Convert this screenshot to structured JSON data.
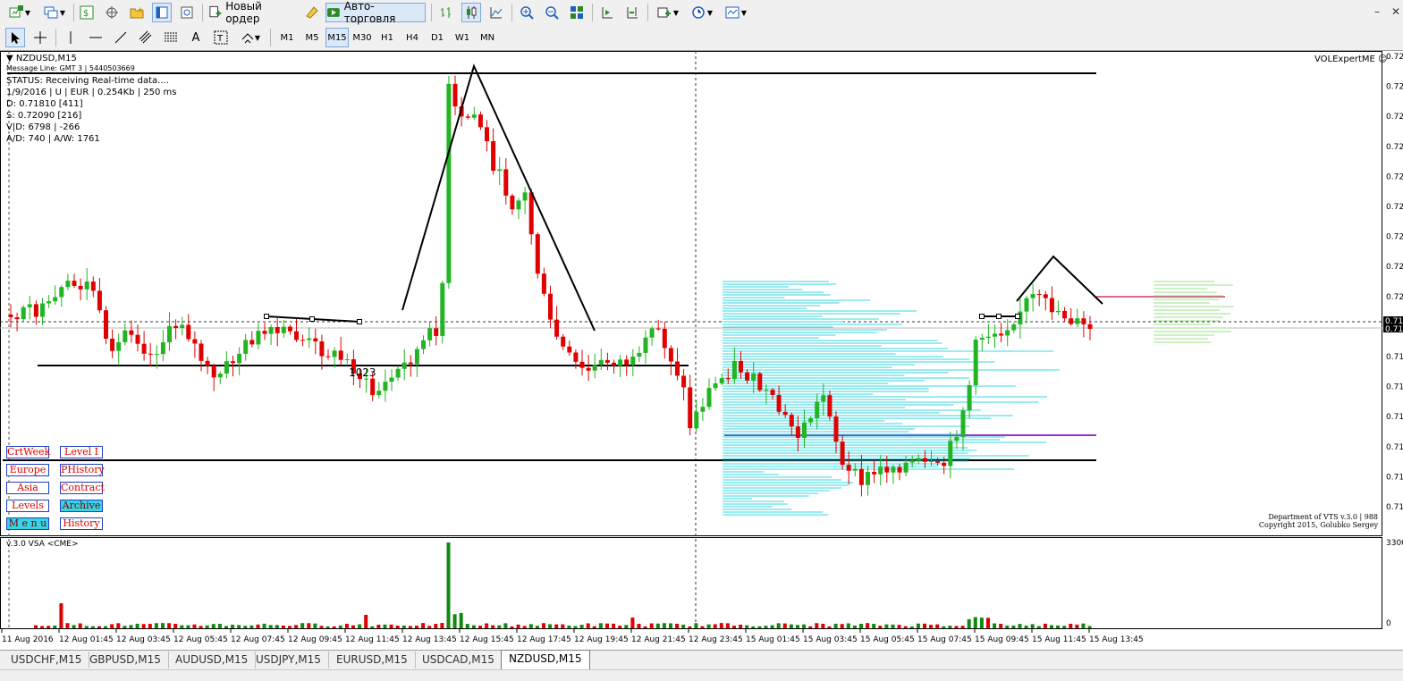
{
  "toolbar": {
    "new_order_label": "Новый ордер",
    "autotrading_label": "Авто-торговля",
    "timeframes": [
      "M1",
      "M5",
      "M15",
      "M30",
      "H1",
      "H4",
      "D1",
      "W1",
      "MN"
    ],
    "active_timeframe": "M15"
  },
  "chart": {
    "symbol_title": "NZDUSD,M15",
    "message_line": "Message Line: GMT 3 | 5440503669",
    "status": "STATUS:  Receiving Real-time data....",
    "info_line1": "1/9/2016 | U | EUR | 0.254Kb | 250 ms",
    "info_d": "D: 0.71810  [411]",
    "info_s": "S: 0.72090  [216]",
    "info_vd": "V|D: 6798 | -266",
    "info_aw": "A/D: 740 | A/W: 1761",
    "expert_name": "VOLExpertME",
    "level_label": "1023",
    "copyright1": "Department of VTS  v.3.0 | 988",
    "copyright2": "Copyright 2015, Golubko Sergey",
    "indicator_label": "v.3.0 VSA  <CME>",
    "volume_scale_top": "3300",
    "volume_scale_bottom": "0",
    "price_ticks": [
      "0.72",
      "0.72",
      "0.72",
      "0.72",
      "0.72",
      "0.72",
      "0.72",
      "0.72",
      "0.72",
      "0.71",
      "0.71",
      "0.71",
      "0.71",
      "0.71",
      "0.71",
      "0.71"
    ],
    "current_price_a": "0.71",
    "current_price_b": "0.71",
    "time_labels": [
      "11 Aug 2016",
      "12 Aug 01:45",
      "12 Aug 03:45",
      "12 Aug 05:45",
      "12 Aug 07:45",
      "12 Aug 09:45",
      "12 Aug 11:45",
      "12 Aug 13:45",
      "12 Aug 15:45",
      "12 Aug 17:45",
      "12 Aug 19:45",
      "12 Aug 21:45",
      "12 Aug 23:45",
      "15 Aug 01:45",
      "15 Aug 03:45",
      "15 Aug 05:45",
      "15 Aug 07:45",
      "15 Aug 09:45",
      "15 Aug 11:45",
      "15 Aug 13:45"
    ],
    "buttons_left": [
      "CrtWeek",
      "Europe",
      "Asia",
      "Levels",
      "M e n u"
    ],
    "buttons_right": [
      "Level I",
      "PHistory",
      "Contract",
      "Archive",
      "History"
    ],
    "colors": {
      "bull": "#22b422",
      "bear": "#e00000",
      "profile": "#36d8e0",
      "purple": "#9b30c8",
      "magenta": "#d6336b",
      "lightgreen": "#9be08a"
    }
  },
  "tabs": [
    "USDCHF,M15",
    "GBPUSD,M15",
    "AUDUSD,M15",
    "USDJPY,M15",
    "EURUSD,M15",
    "USDCAD,M15",
    "NZDUSD,M15"
  ],
  "active_tab": "NZDUSD,M15"
}
